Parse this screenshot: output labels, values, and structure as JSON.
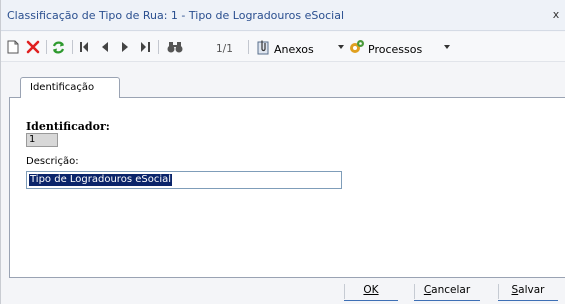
{
  "window": {
    "title": "Classificação de Tipo de Rua: 1 - Tipo de Logradouros eSocial",
    "close_label": "x"
  },
  "toolbar": {
    "record_counter": "1/1",
    "anexos_label": "Anexos",
    "processos_label": "Processos",
    "icons": [
      "new-document-icon",
      "delete-icon",
      "refresh-icon",
      "first-record-icon",
      "previous-record-icon",
      "next-record-icon",
      "last-record-icon",
      "find-icon",
      "attachment-icon",
      "process-icon"
    ]
  },
  "tabs": [
    {
      "label": "Identificação",
      "active": true
    }
  ],
  "form": {
    "identificador_label": "Identificador:",
    "identificador_value": "1",
    "descricao_label": "Descrição:",
    "descricao_value": "Tipo de Logradouros eSocial"
  },
  "buttons": {
    "ok": {
      "label": "OK",
      "mnemonic": "O"
    },
    "cancelar": {
      "label": "Cancelar",
      "mnemonic": "C"
    },
    "salvar": {
      "label": "Salvar",
      "mnemonic": "S"
    }
  },
  "colors": {
    "title_text": "#2a4f8f",
    "delete_red": "#e02020",
    "refresh_green": "#2f9a2f",
    "selection": "#0a246a",
    "button_underline": "#3d6fb5"
  }
}
